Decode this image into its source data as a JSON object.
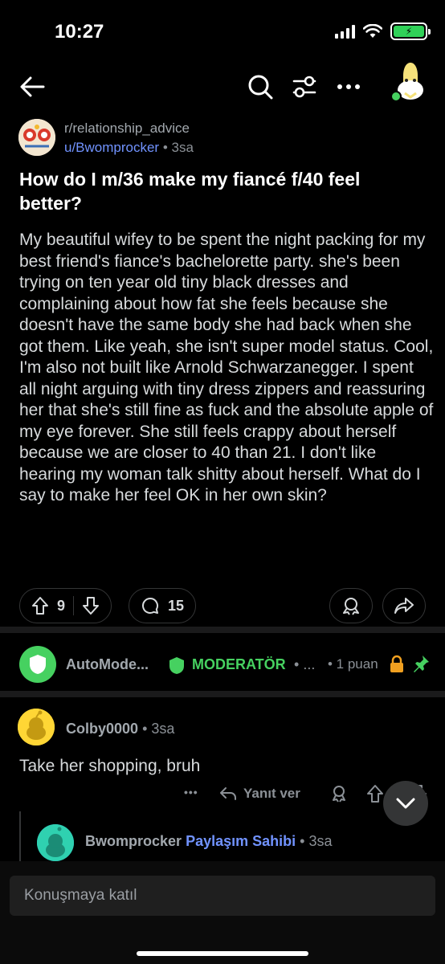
{
  "status_bar": {
    "time": "10:27"
  },
  "nav": {
    "back_icon": "arrow-left-icon",
    "search_icon": "search-icon",
    "filter_icon": "sliders-icon",
    "more_icon": "ellipsis-icon"
  },
  "post": {
    "subreddit": "r/relationship_advice",
    "author": "u/Bwomprocker",
    "separator": "•",
    "age": "3sa",
    "title": "How do I m/36 make my fiancé f/40 feel better?",
    "body": "My beautiful wifey to be spent the night packing for my best friend's fiance's bachelorette party. she's been trying on ten year old tiny black dresses and complaining about how fat she feels because she doesn't have the same body she had back when she got them. Like yeah, she isn't super model status. Cool, I'm also not built like Arnold Schwarzanegger. I spent all night arguing with tiny dress zippers and reassuring her that she's still fine as fuck and the absolute apple of my eye forever. She still feels crappy about herself because we are closer to 40 than 21. I don't like hearing my woman talk shitty about herself. What do I say to make her feel OK in her own skin?",
    "votes": "9",
    "comments": "15"
  },
  "automod": {
    "name": "AutoMode...",
    "badge": "MODERATÖR",
    "sep": "•",
    "more": "...",
    "points": "• 1 puan"
  },
  "comment": {
    "user": "Colby0000",
    "age": "• 3sa",
    "text": "Take her shopping, bruh",
    "more": "•••",
    "reply_label": "Yanıt ver",
    "votes": "8"
  },
  "reply": {
    "user": "Bwomprocker",
    "op_label": "Paylaşım Sahibi",
    "age": "• 3sa"
  },
  "composer": {
    "placeholder": "Konuşmaya katıl"
  },
  "colors": {
    "accent_blue": "#7193ff",
    "mod_green": "#46d160",
    "bg": "#000000"
  }
}
